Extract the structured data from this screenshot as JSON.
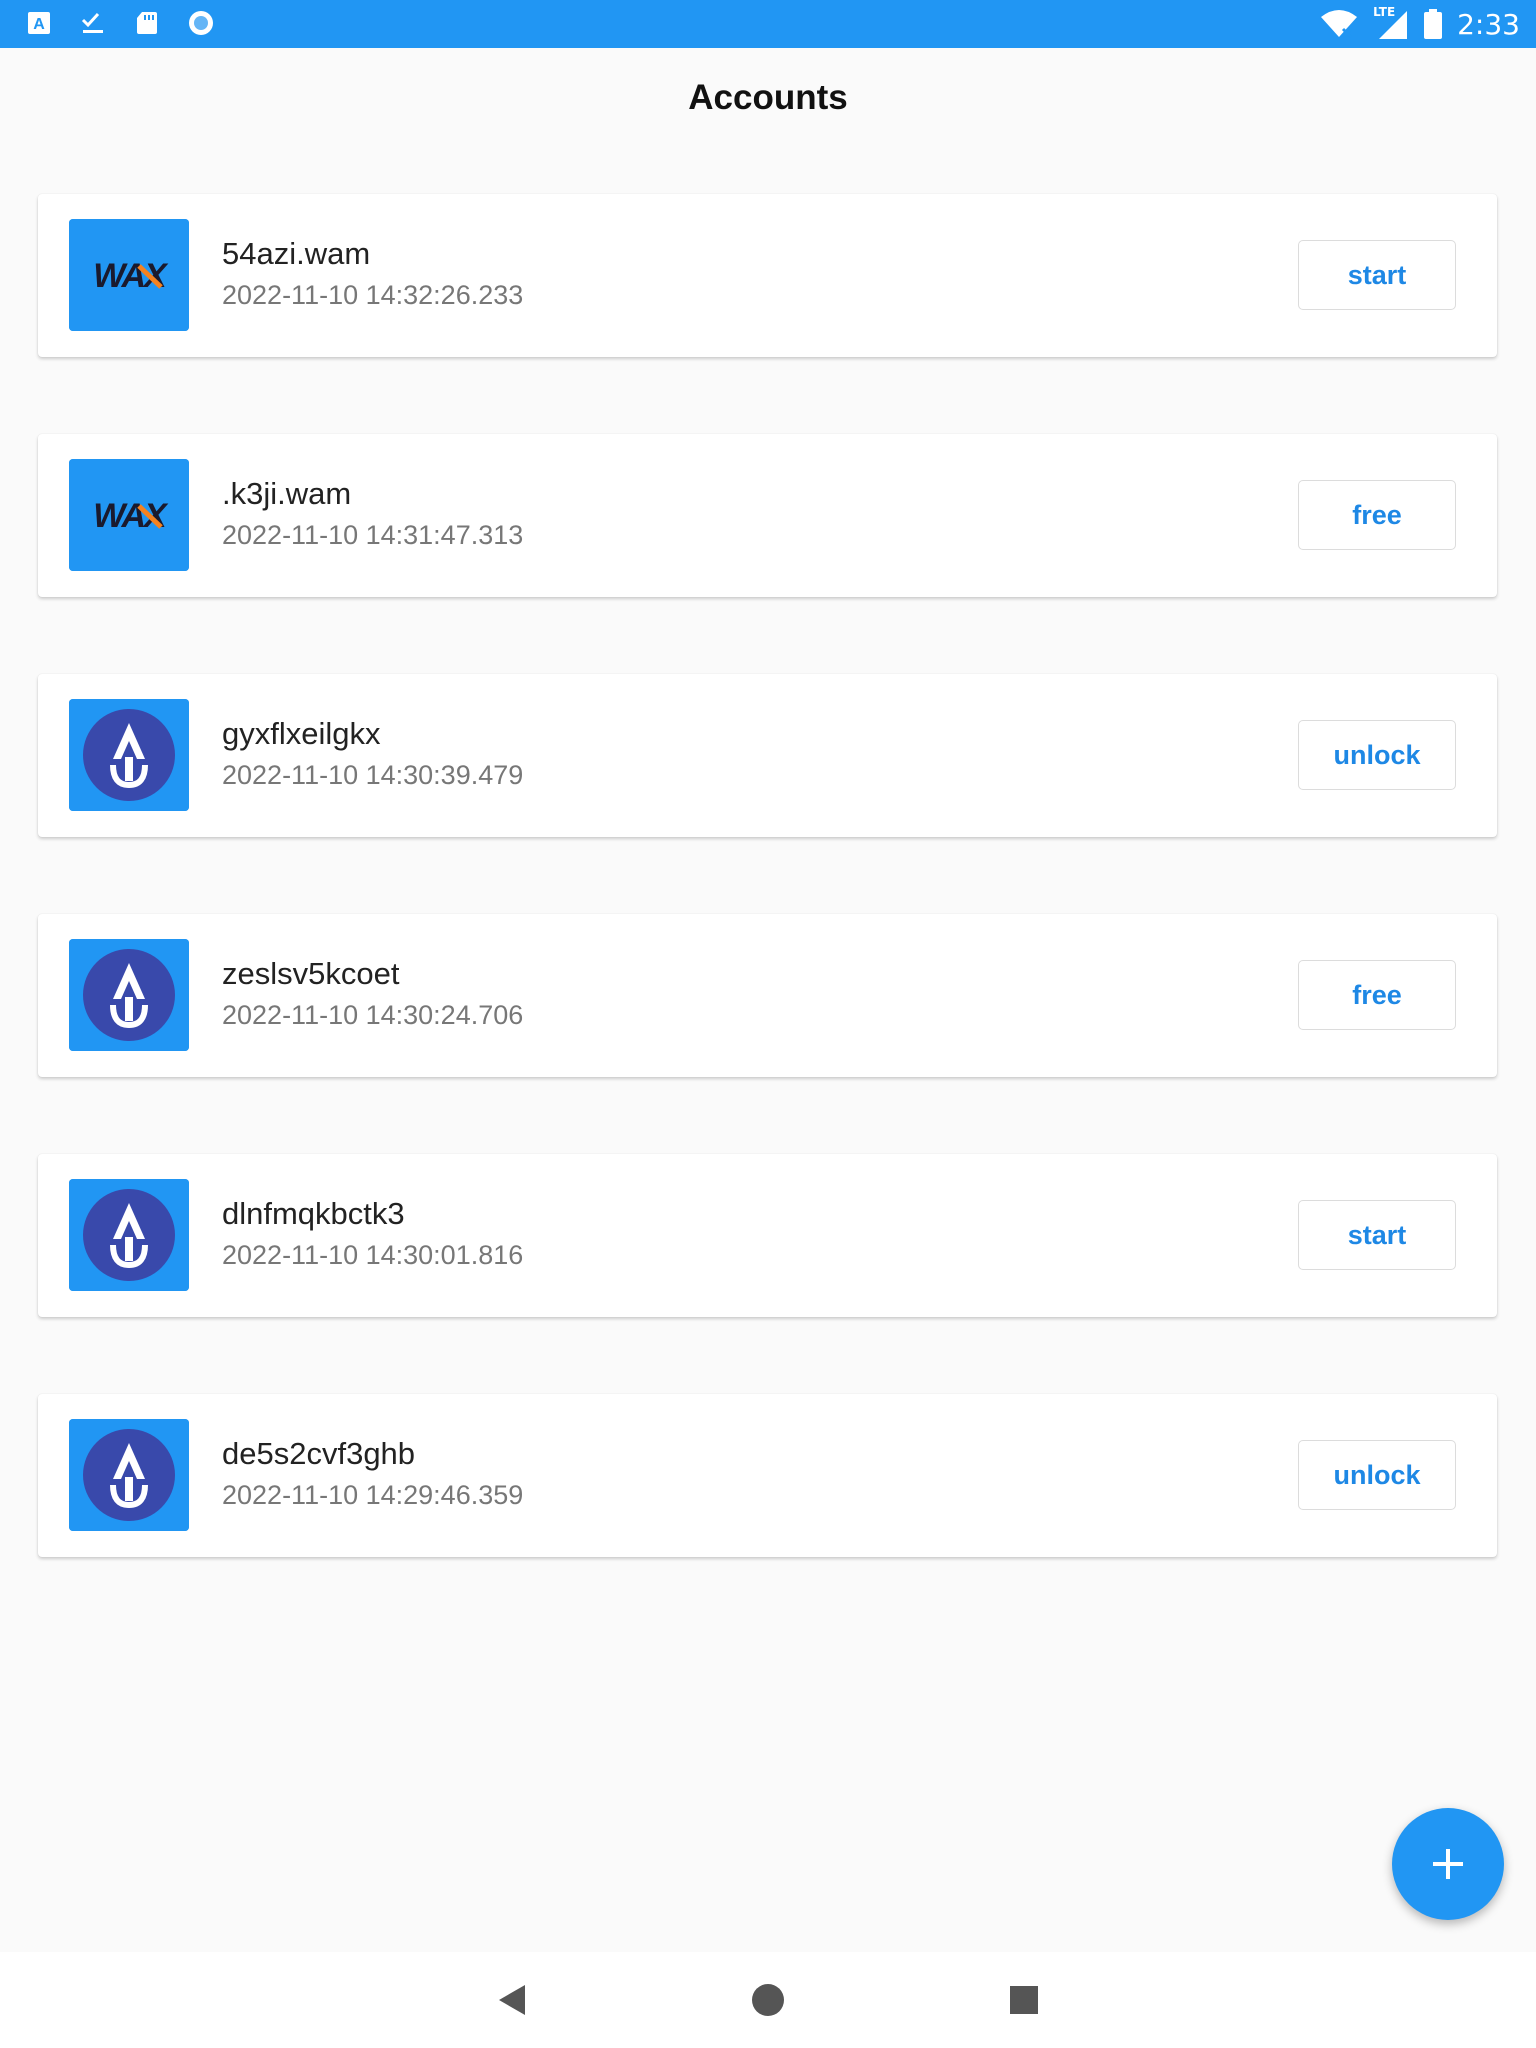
{
  "status_bar": {
    "time": "2:33",
    "network_label": "LTE",
    "icons": [
      "a-notification-icon",
      "checklist-icon",
      "sd-card-icon",
      "circle-app-icon",
      "wifi-icon",
      "signal-icon",
      "battery-icon"
    ],
    "background_color": "#2196f3"
  },
  "header": {
    "title": "Accounts"
  },
  "accounts": [
    {
      "logo": "wax-logo",
      "logo_text": "WAX",
      "name": "54azi.wam",
      "timestamp": "2022-11-10 14:32:26.233",
      "action": "start"
    },
    {
      "logo": "wax-logo",
      "logo_text": "WAX",
      "name": ".k3ji.wam",
      "timestamp": "2022-11-10 14:31:47.313",
      "action": "free"
    },
    {
      "logo": "anchor-logo",
      "name": "gyxflxeilgkx",
      "timestamp": "2022-11-10 14:30:39.479",
      "action": "unlock"
    },
    {
      "logo": "anchor-logo",
      "name": "zeslsv5kcoet",
      "timestamp": "2022-11-10 14:30:24.706",
      "action": "free"
    },
    {
      "logo": "anchor-logo",
      "name": "dlnfmqkbctk3",
      "timestamp": "2022-11-10 14:30:01.816",
      "action": "start"
    },
    {
      "logo": "anchor-logo",
      "name": "de5s2cvf3ghb",
      "timestamp": "2022-11-10 14:29:46.359",
      "action": "unlock"
    }
  ],
  "fab": {
    "icon": "plus-icon"
  },
  "nav_bar": {
    "buttons": [
      "back-icon",
      "home-icon",
      "recents-icon"
    ]
  },
  "colors": {
    "accent": "#2196f3",
    "button_text": "#1e88e5",
    "anchor_circle": "#3949ab"
  }
}
